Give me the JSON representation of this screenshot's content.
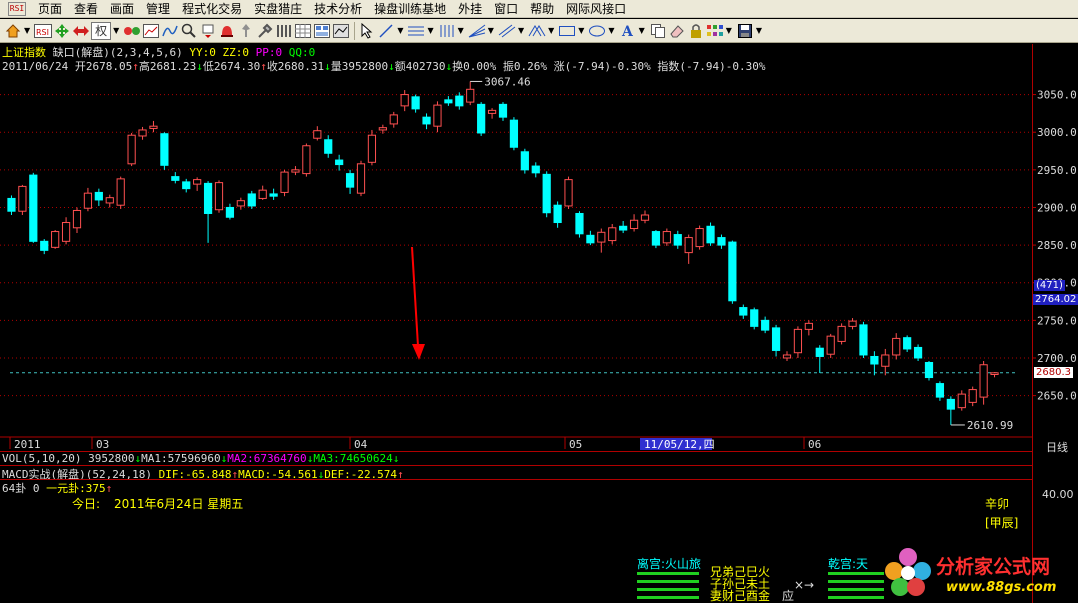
{
  "window": {
    "app_icon_text": "RSI"
  },
  "menu": [
    "页面",
    "查看",
    "画面",
    "管理",
    "程式化交易",
    "实盘猎庄",
    "技术分析",
    "操盘训练基地",
    "外挂",
    "窗口",
    "帮助",
    "网际风接口"
  ],
  "toolbar": {
    "quan_label": "权"
  },
  "chart_header": {
    "name": "上证指数",
    "indicator_name": "缺口(解盘)",
    "indicator_params": "(2,3,4,5,6)",
    "yy": "YY:0",
    "zz": "ZZ:0",
    "pp": "PP:0",
    "qq": "QQ:0"
  },
  "quote": {
    "date": "2011/06/24",
    "open": "开2678.05",
    "high": "高2681.23",
    "low": "低2674.30",
    "close": "收2680.31",
    "volume": "量3952800",
    "amount": "额402730",
    "turnover": "换0.00%",
    "amplitude": "振0.26%",
    "change": "涨(-7.94)-0.30%",
    "index_change": "指数(-7.94)-0.30%"
  },
  "annotations": {
    "high_label": "3067.46",
    "low_label": "2610.99"
  },
  "price_axis": {
    "ticks": [
      "3050.0",
      "3000.0",
      "2950.0",
      "2900.0",
      "2850.0",
      "2800.0",
      "2750.0",
      "2700.0",
      "2650.0"
    ],
    "badge_count": "(471)",
    "badge_price": "2764.02",
    "last_price": "2680.3",
    "period_label": "日线"
  },
  "time_axis": {
    "labels": [
      "2011",
      "03",
      "04",
      "05",
      "06"
    ],
    "cursor_date": "11/05/12,四"
  },
  "vol_indicator": {
    "name": "VOL(5,10,20)",
    "value": "3952800",
    "ma1": "MA1:57596960",
    "ma2": "MA2:67364760",
    "ma3": "MA3:74650624"
  },
  "macd_indicator": {
    "name": "MACD实战(解盘)",
    "params": "(52,24,18)",
    "dif": "DIF:-65.848",
    "macd": "MACD:-54.561",
    "dea": "DEF:-22.574"
  },
  "gua_panel": {
    "title": "64卦 0",
    "yuan": "一元卦:375",
    "today_label": "今日:",
    "today_date": "2011年6月24日 星期五",
    "ganzhi": "辛卯",
    "ganzhi2": "[甲辰]",
    "axis_value": "40.00",
    "li_gong": "离宫:火山旅",
    "line1": "兄弟己巳火",
    "line2": "子孙己未土",
    "line3": "妻财己酉金",
    "ying": "应",
    "arrow": "×→",
    "qian_gong": "乾宫:天"
  },
  "logo": {
    "text": "分析家公式网",
    "url": "www.88gs.com"
  },
  "colors": {
    "up": "#ff5050",
    "down": "#00ffff",
    "grid": "#b00000",
    "arrow": "#ff0000",
    "highlight": "#3030d0"
  },
  "chart_data": {
    "type": "candlestick",
    "period": "daily",
    "ylim": [
      2595,
      3080
    ],
    "reference_price": 2680.31,
    "candles": [
      {
        "o": 2912,
        "c": 2895,
        "h": 2916,
        "l": 2890
      },
      {
        "o": 2895,
        "c": 2928,
        "h": 2930,
        "l": 2890
      },
      {
        "o": 2943,
        "c": 2855,
        "h": 2946,
        "l": 2853
      },
      {
        "o": 2855,
        "c": 2843,
        "h": 2858,
        "l": 2838
      },
      {
        "o": 2847,
        "c": 2868,
        "h": 2870,
        "l": 2845
      },
      {
        "o": 2855,
        "c": 2880,
        "h": 2887,
        "l": 2851
      },
      {
        "o": 2873,
        "c": 2896,
        "h": 2900,
        "l": 2866
      },
      {
        "o": 2899,
        "c": 2919,
        "h": 2926,
        "l": 2895
      },
      {
        "o": 2920,
        "c": 2910,
        "h": 2925,
        "l": 2902
      },
      {
        "o": 2906,
        "c": 2913,
        "h": 2917,
        "l": 2900
      },
      {
        "o": 2903,
        "c": 2938,
        "h": 2941,
        "l": 2898
      },
      {
        "o": 2958,
        "c": 2996,
        "h": 2999,
        "l": 2955
      },
      {
        "o": 2995,
        "c": 3003,
        "h": 3007,
        "l": 2990
      },
      {
        "o": 3005,
        "c": 3008,
        "h": 3015,
        "l": 3000
      },
      {
        "o": 2998,
        "c": 2956,
        "h": 3000,
        "l": 2950
      },
      {
        "o": 2941,
        "c": 2936,
        "h": 2947,
        "l": 2932
      },
      {
        "o": 2934,
        "c": 2925,
        "h": 2938,
        "l": 2920
      },
      {
        "o": 2931,
        "c": 2937,
        "h": 2940,
        "l": 2922
      },
      {
        "o": 2932,
        "c": 2892,
        "h": 2935,
        "l": 2853
      },
      {
        "o": 2897,
        "c": 2933,
        "h": 2936,
        "l": 2893
      },
      {
        "o": 2900,
        "c": 2887,
        "h": 2905,
        "l": 2884
      },
      {
        "o": 2902,
        "c": 2909,
        "h": 2913,
        "l": 2897
      },
      {
        "o": 2918,
        "c": 2902,
        "h": 2922,
        "l": 2898
      },
      {
        "o": 2912,
        "c": 2923,
        "h": 2929,
        "l": 2910
      },
      {
        "o": 2918,
        "c": 2915,
        "h": 2925,
        "l": 2910
      },
      {
        "o": 2920,
        "c": 2947,
        "h": 2950,
        "l": 2915
      },
      {
        "o": 2947,
        "c": 2950,
        "h": 2955,
        "l": 2943
      },
      {
        "o": 2945,
        "c": 2982,
        "h": 2985,
        "l": 2941
      },
      {
        "o": 2992,
        "c": 3002,
        "h": 3008,
        "l": 2989
      },
      {
        "o": 2990,
        "c": 2972,
        "h": 2996,
        "l": 2966
      },
      {
        "o": 2963,
        "c": 2957,
        "h": 2970,
        "l": 2949
      },
      {
        "o": 2945,
        "c": 2927,
        "h": 2950,
        "l": 2918
      },
      {
        "o": 2919,
        "c": 2958,
        "h": 2962,
        "l": 2915
      },
      {
        "o": 2960,
        "c": 2996,
        "h": 3003,
        "l": 2956
      },
      {
        "o": 3003,
        "c": 3006,
        "h": 3010,
        "l": 2998
      },
      {
        "o": 3011,
        "c": 3023,
        "h": 3027,
        "l": 3006
      },
      {
        "o": 3035,
        "c": 3050,
        "h": 3056,
        "l": 3028
      },
      {
        "o": 3047,
        "c": 3031,
        "h": 3050,
        "l": 3026
      },
      {
        "o": 3020,
        "c": 3011,
        "h": 3025,
        "l": 3004
      },
      {
        "o": 3008,
        "c": 3036,
        "h": 3041,
        "l": 3000
      },
      {
        "o": 3043,
        "c": 3039,
        "h": 3048,
        "l": 3035
      },
      {
        "o": 3048,
        "c": 3035,
        "h": 3053,
        "l": 3030
      },
      {
        "o": 3040,
        "c": 3057,
        "h": 3067.46,
        "l": 3036
      },
      {
        "o": 3037,
        "c": 2999,
        "h": 3040,
        "l": 2995
      },
      {
        "o": 3025,
        "c": 3029,
        "h": 3032,
        "l": 3018
      },
      {
        "o": 3037,
        "c": 3020,
        "h": 3040,
        "l": 3015
      },
      {
        "o": 3016,
        "c": 2980,
        "h": 3020,
        "l": 2976
      },
      {
        "o": 2974,
        "c": 2950,
        "h": 2978,
        "l": 2945
      },
      {
        "o": 2955,
        "c": 2946,
        "h": 2960,
        "l": 2940
      },
      {
        "o": 2944,
        "c": 2893,
        "h": 2948,
        "l": 2887
      },
      {
        "o": 2903,
        "c": 2880,
        "h": 2908,
        "l": 2873
      },
      {
        "o": 2902,
        "c": 2937,
        "h": 2941,
        "l": 2898
      },
      {
        "o": 2892,
        "c": 2865,
        "h": 2895,
        "l": 2860
      },
      {
        "o": 2863,
        "c": 2853,
        "h": 2869,
        "l": 2850
      },
      {
        "o": 2854,
        "c": 2867,
        "h": 2872,
        "l": 2840
      },
      {
        "o": 2856,
        "c": 2873,
        "h": 2878,
        "l": 2851
      },
      {
        "o": 2875,
        "c": 2870,
        "h": 2882,
        "l": 2866
      },
      {
        "o": 2872,
        "c": 2883,
        "h": 2891,
        "l": 2868
      },
      {
        "o": 2883,
        "c": 2890,
        "h": 2896,
        "l": 2879
      },
      {
        "o": 2868,
        "c": 2850,
        "h": 2870,
        "l": 2846
      },
      {
        "o": 2853,
        "c": 2868,
        "h": 2872,
        "l": 2849
      },
      {
        "o": 2864,
        "c": 2850,
        "h": 2869,
        "l": 2845
      },
      {
        "o": 2840,
        "c": 2860,
        "h": 2864,
        "l": 2825
      },
      {
        "o": 2848,
        "c": 2872,
        "h": 2876,
        "l": 2844
      },
      {
        "o": 2875,
        "c": 2853,
        "h": 2880,
        "l": 2849
      },
      {
        "o": 2860,
        "c": 2850,
        "h": 2864,
        "l": 2845
      },
      {
        "o": 2854,
        "c": 2776,
        "h": 2856,
        "l": 2772
      },
      {
        "o": 2767,
        "c": 2757,
        "h": 2771,
        "l": 2752
      },
      {
        "o": 2764,
        "c": 2742,
        "h": 2767,
        "l": 2738
      },
      {
        "o": 2750,
        "c": 2737,
        "h": 2755,
        "l": 2733
      },
      {
        "o": 2740,
        "c": 2710,
        "h": 2744,
        "l": 2702
      },
      {
        "o": 2700,
        "c": 2704,
        "h": 2709,
        "l": 2696
      },
      {
        "o": 2707,
        "c": 2738,
        "h": 2742,
        "l": 2700
      },
      {
        "o": 2738,
        "c": 2746,
        "h": 2750,
        "l": 2730
      },
      {
        "o": 2713,
        "c": 2702,
        "h": 2717,
        "l": 2680
      },
      {
        "o": 2705,
        "c": 2729,
        "h": 2732,
        "l": 2700
      },
      {
        "o": 2722,
        "c": 2742,
        "h": 2746,
        "l": 2718
      },
      {
        "o": 2742,
        "c": 2749,
        "h": 2753,
        "l": 2738
      },
      {
        "o": 2744,
        "c": 2704,
        "h": 2748,
        "l": 2700
      },
      {
        "o": 2702,
        "c": 2692,
        "h": 2709,
        "l": 2677
      },
      {
        "o": 2689,
        "c": 2704,
        "h": 2712,
        "l": 2677
      },
      {
        "o": 2704,
        "c": 2726,
        "h": 2733,
        "l": 2698
      },
      {
        "o": 2727,
        "c": 2712,
        "h": 2730,
        "l": 2708
      },
      {
        "o": 2714,
        "c": 2700,
        "h": 2718,
        "l": 2696
      },
      {
        "o": 2694,
        "c": 2674,
        "h": 2696,
        "l": 2670
      },
      {
        "o": 2666,
        "c": 2648,
        "h": 2669,
        "l": 2643
      },
      {
        "o": 2645,
        "c": 2632,
        "h": 2649,
        "l": 2610.99
      },
      {
        "o": 2634,
        "c": 2652,
        "h": 2657,
        "l": 2630
      },
      {
        "o": 2641,
        "c": 2658,
        "h": 2662,
        "l": 2636
      },
      {
        "o": 2648,
        "c": 2691,
        "h": 2696,
        "l": 2638
      },
      {
        "o": 2678.05,
        "c": 2680.31,
        "h": 2681.23,
        "l": 2674.3
      }
    ]
  }
}
